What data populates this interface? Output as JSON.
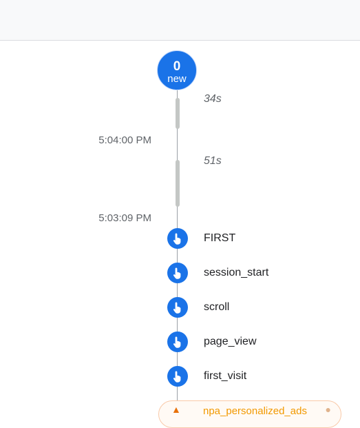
{
  "badge": {
    "count": "0",
    "label": "new"
  },
  "gaps": [
    {
      "duration": "34s"
    },
    {
      "duration": "51s"
    }
  ],
  "times": [
    "5:04:00 PM",
    "5:03:09 PM"
  ],
  "events": [
    {
      "name": "FIRST",
      "icon": "touch-icon"
    },
    {
      "name": "session_start",
      "icon": "touch-icon"
    },
    {
      "name": "scroll",
      "icon": "touch-icon"
    },
    {
      "name": "page_view",
      "icon": "touch-icon"
    },
    {
      "name": "first_visit",
      "icon": "touch-icon"
    }
  ],
  "warning_event": {
    "name": "npa_personalized_ads",
    "icon": "warning-icon"
  },
  "colors": {
    "accent": "#1a73e8",
    "warning": "#f29900"
  }
}
